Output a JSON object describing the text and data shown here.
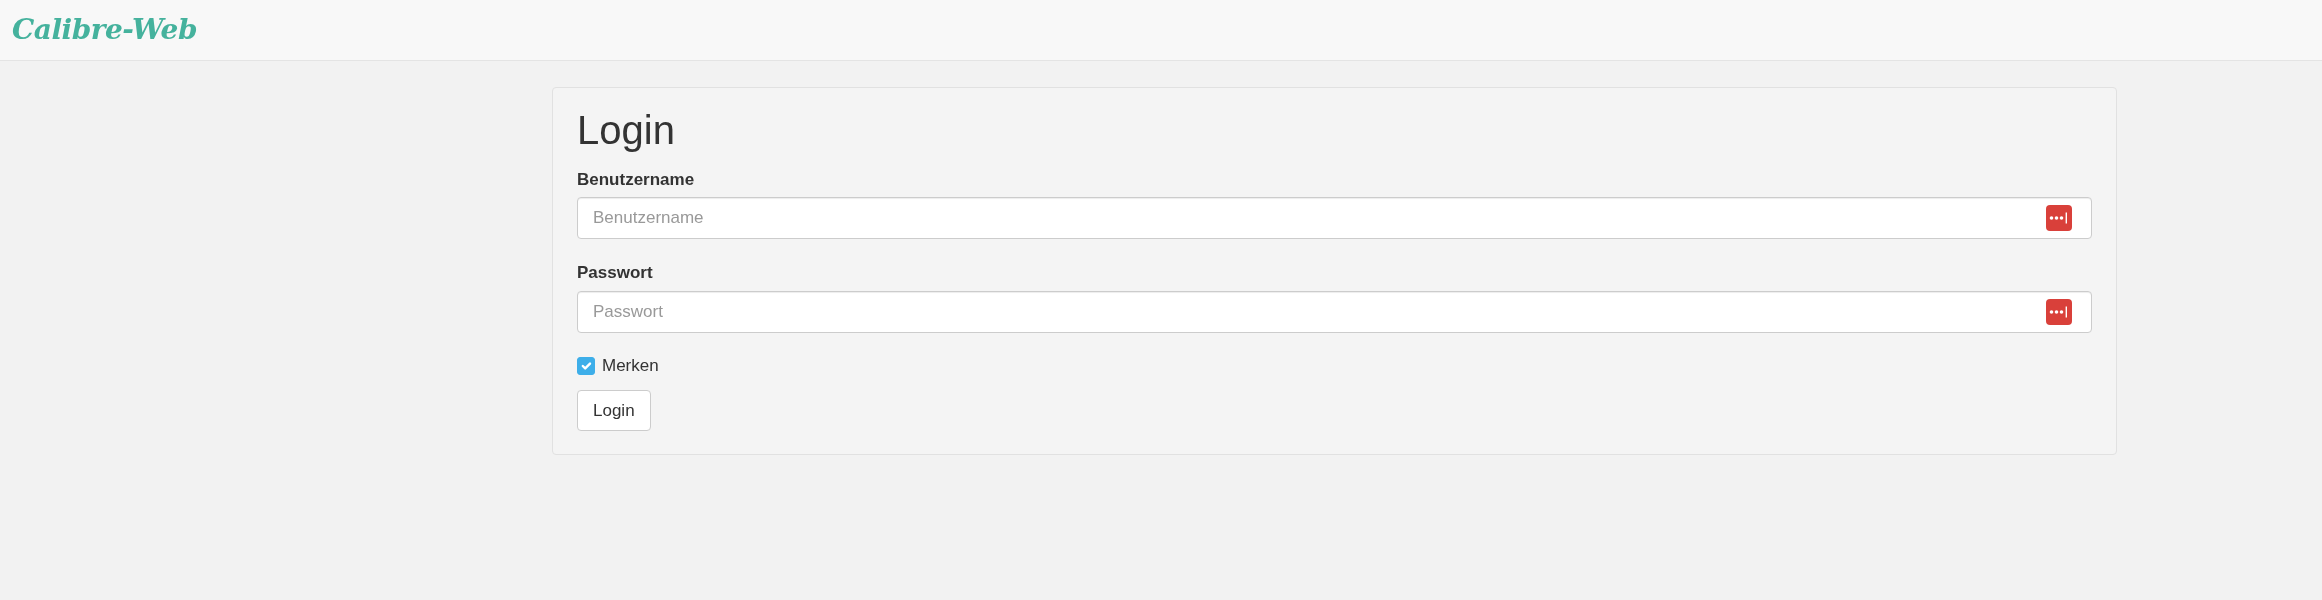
{
  "navbar": {
    "brand": "Calibre-Web"
  },
  "login": {
    "title": "Login",
    "fields": [
      {
        "label": "Benutzername",
        "placeholder": "Benutzername"
      },
      {
        "label": "Passwort",
        "placeholder": "Passwort"
      }
    ],
    "remember": {
      "label": "Merken",
      "checked": true
    },
    "button": "Login"
  }
}
